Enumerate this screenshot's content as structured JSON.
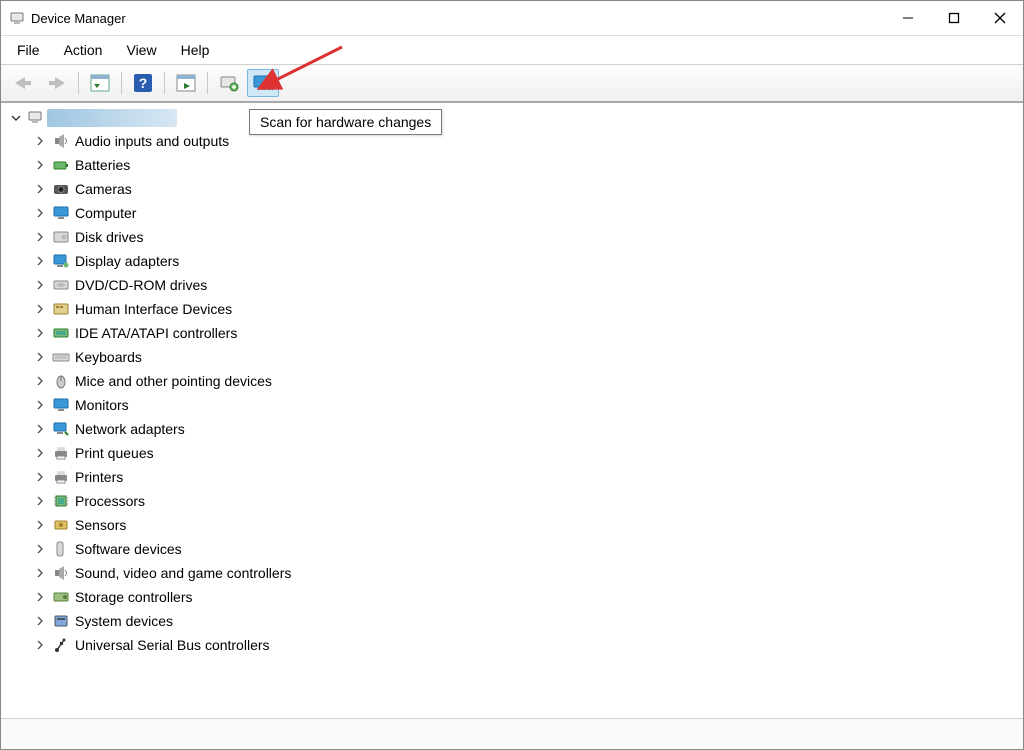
{
  "window": {
    "title": "Device Manager"
  },
  "menus": {
    "file": "File",
    "action": "Action",
    "view": "View",
    "help": "Help"
  },
  "tooltip": "Scan for hardware changes",
  "tree": {
    "items": [
      {
        "label": "Audio inputs and outputs",
        "icon": "speaker"
      },
      {
        "label": "Batteries",
        "icon": "battery"
      },
      {
        "label": "Cameras",
        "icon": "camera"
      },
      {
        "label": "Computer",
        "icon": "monitor"
      },
      {
        "label": "Disk drives",
        "icon": "disk"
      },
      {
        "label": "Display adapters",
        "icon": "display-adapter"
      },
      {
        "label": "DVD/CD-ROM drives",
        "icon": "optical"
      },
      {
        "label": "Human Interface Devices",
        "icon": "hid"
      },
      {
        "label": "IDE ATA/ATAPI controllers",
        "icon": "ide"
      },
      {
        "label": "Keyboards",
        "icon": "keyboard"
      },
      {
        "label": "Mice and other pointing devices",
        "icon": "mouse"
      },
      {
        "label": "Monitors",
        "icon": "monitor"
      },
      {
        "label": "Network adapters",
        "icon": "network"
      },
      {
        "label": "Print queues",
        "icon": "printer"
      },
      {
        "label": "Printers",
        "icon": "printer"
      },
      {
        "label": "Processors",
        "icon": "cpu"
      },
      {
        "label": "Sensors",
        "icon": "sensor"
      },
      {
        "label": "Software devices",
        "icon": "software"
      },
      {
        "label": "Sound, video and game controllers",
        "icon": "speaker"
      },
      {
        "label": "Storage controllers",
        "icon": "storage"
      },
      {
        "label": "System devices",
        "icon": "system"
      },
      {
        "label": "Universal Serial Bus controllers",
        "icon": "usb"
      }
    ]
  }
}
